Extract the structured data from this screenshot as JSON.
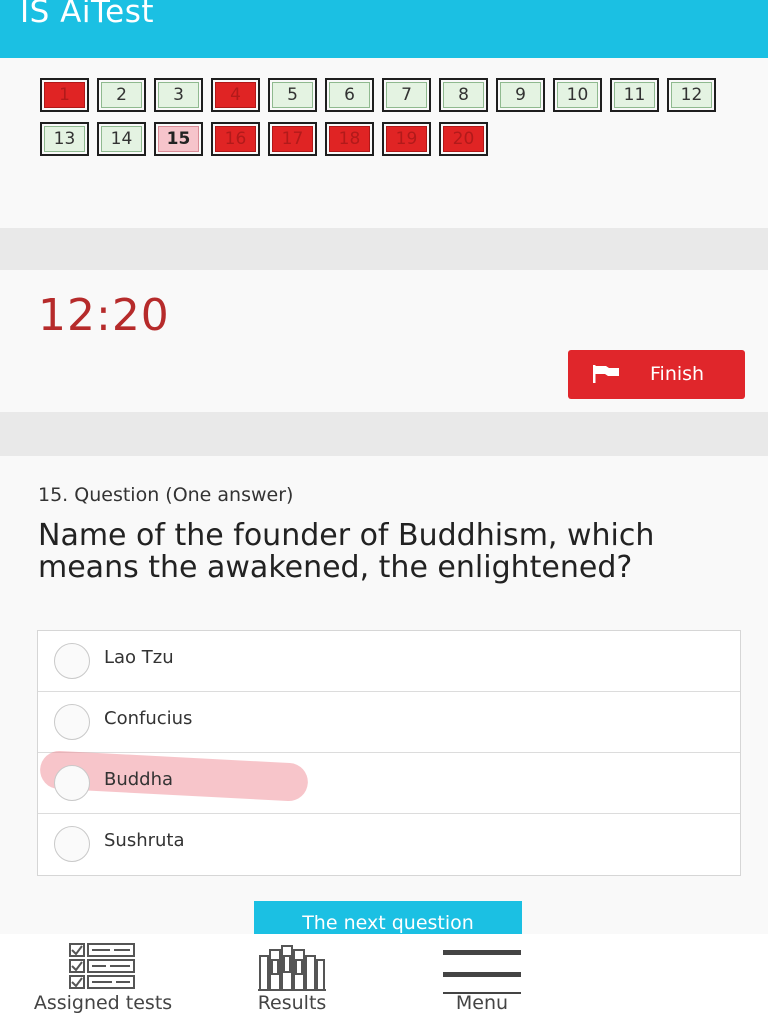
{
  "app": {
    "title": "IS AiTest"
  },
  "question_nav": {
    "items": [
      {
        "label": "1",
        "state": "answered"
      },
      {
        "label": "2",
        "state": "unanswered"
      },
      {
        "label": "3",
        "state": "unanswered"
      },
      {
        "label": "4",
        "state": "answered"
      },
      {
        "label": "5",
        "state": "unanswered"
      },
      {
        "label": "6",
        "state": "unanswered"
      },
      {
        "label": "7",
        "state": "unanswered"
      },
      {
        "label": "8",
        "state": "unanswered"
      },
      {
        "label": "9",
        "state": "unanswered"
      },
      {
        "label": "10",
        "state": "unanswered"
      },
      {
        "label": "11",
        "state": "unanswered"
      },
      {
        "label": "12",
        "state": "unanswered"
      },
      {
        "label": "13",
        "state": "unanswered"
      },
      {
        "label": "14",
        "state": "unanswered"
      },
      {
        "label": "15",
        "state": "current"
      },
      {
        "label": "16",
        "state": "answered"
      },
      {
        "label": "17",
        "state": "answered"
      },
      {
        "label": "18",
        "state": "answered"
      },
      {
        "label": "19",
        "state": "answered"
      },
      {
        "label": "20",
        "state": "answered"
      }
    ]
  },
  "timer": {
    "value": "12:20"
  },
  "finish": {
    "label": "Finish",
    "icon": "flag-icon"
  },
  "question": {
    "meta": "15. Question (One answer)",
    "text": "Name of the founder of Buddhism, which means the awakened, the enlightened?",
    "answers": [
      {
        "label": "Lao Tzu",
        "highlighted": false
      },
      {
        "label": "Confucius",
        "highlighted": false
      },
      {
        "label": "Buddha",
        "highlighted": true
      },
      {
        "label": "Sushruta",
        "highlighted": false
      }
    ]
  },
  "next": {
    "label": "The next question"
  },
  "bottom_nav": {
    "assigned": {
      "label": "Assigned tests",
      "icon": "checklist-icon"
    },
    "results": {
      "label": "Results",
      "icon": "books-icon"
    },
    "menu": {
      "label": "Menu",
      "icon": "hamburger-menu-icon"
    }
  },
  "colors": {
    "accent": "#1bc0e3",
    "answered": "#e02424",
    "unanswered": "#e4f3e2",
    "current": "#f6c4cb",
    "timer": "#b62b2b",
    "finish_button": "#e0262b"
  }
}
